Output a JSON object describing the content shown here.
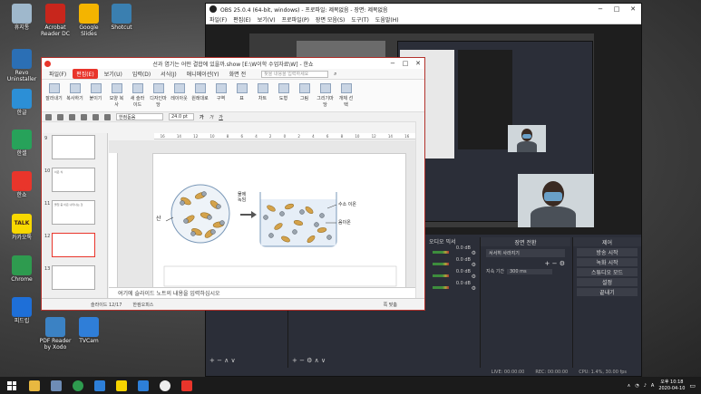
{
  "desktop": {
    "icons": [
      {
        "label": "휴지통",
        "color": "#9fb8cc"
      },
      {
        "label": "Acrobat Reader DC",
        "color": "#c8261c"
      },
      {
        "label": "Google Slides",
        "color": "#f4b400"
      },
      {
        "label": "Shotcut",
        "color": "#3a7fb0"
      },
      {
        "label": "Revo Uninstaller",
        "color": "#2b6fb5"
      },
      {
        "label": "한글",
        "color": "#2c8fd6"
      },
      {
        "label": "한셀",
        "color": "#27a25a"
      },
      {
        "label": "한쇼",
        "color": "#e9352b"
      },
      {
        "label": "카카오톡",
        "color": "#f8d800",
        "badge": "TALK"
      },
      {
        "label": "Chrome",
        "color": "#2e9b4f"
      },
      {
        "label": "피드립",
        "color": "#1e6fd8"
      },
      {
        "label": "PDF Reader by Xodo",
        "color": "#3b82c4"
      },
      {
        "label": "TVCam",
        "color": "#2f7ed8"
      }
    ]
  },
  "obs": {
    "title": "OBS 25.0.4 (64-bit, windows) - 프로파일: 제목없음 - 장면: 제목없음",
    "menu": [
      "파일(F)",
      "편집(E)",
      "보기(V)",
      "프로파일(P)",
      "장면 모음(S)",
      "도구(T)",
      "도움말(H)"
    ],
    "mixer": {
      "header": "오디오 믹서",
      "levels": [
        "0.0 dB",
        "0.0 dB",
        "0.0 dB",
        "0.0 dB"
      ]
    },
    "transitions": {
      "header": "장면 전환",
      "type": "서서히 사라지기",
      "duration_label": "지속 기간",
      "duration_value": "300 ms"
    },
    "controls": {
      "header": "제어",
      "buttons": [
        "방송 시작",
        "녹화 시작",
        "스튜디오 모드",
        "설정",
        "끝내기"
      ]
    },
    "status": {
      "live": "LIVE: 00:00:00",
      "rec": "REC: 00:00:00",
      "cpu": "CPU: 1.4%, 30.00 fps"
    }
  },
  "show": {
    "title": "선과 염기는 어떤 결합에 있을까.show [E:\\W이학 수업자료\\W] - 한쇼",
    "tabs": [
      "파일(F)",
      "편집(E)",
      "보기(U)",
      "입력(D)",
      "서식(J)",
      "애니메이션(Y)",
      "화면 전"
    ],
    "active_tab": "편집(E)",
    "search_placeholder": "찾을 내용을 입력하세요",
    "ribbon": [
      "잘라내기",
      "복사하기",
      "붙이기",
      "모양 복사",
      "새 슬라이드",
      "디자인마당",
      "레이아웃",
      "원래대로",
      "구역",
      "표",
      "차트",
      "도형",
      "그림",
      "그리기마당",
      "개체 선택"
    ],
    "toolbar_font": "한컴돋움",
    "toolbar_size": "24.0 pt",
    "ruler": [
      "16",
      "14",
      "12",
      "10",
      "8",
      "6",
      "4",
      "2",
      "0",
      "2",
      "4",
      "6",
      "8",
      "10",
      "12",
      "14",
      "16"
    ],
    "thumbnails": [
      {
        "num": "9",
        "text": ""
      },
      {
        "num": "10",
        "text": "이온 식"
      },
      {
        "num": "11",
        "text": "물질 중 이온 나타나는 것"
      },
      {
        "num": "12",
        "text": ""
      },
      {
        "num": "13",
        "text": ""
      }
    ],
    "slide": {
      "left_label": "산",
      "arrow_label": "물에 녹임",
      "right_labels": [
        "수소 이온",
        "음이온"
      ]
    },
    "notes_placeholder": "여기에 슬라이드 노트의 내용을 입력하십시오",
    "status": {
      "slide": "슬라이드 12/17",
      "theme": "한컴오피스",
      "zoom": "쪽 맞춤"
    }
  },
  "taskbar": {
    "time": "오후 10:18",
    "date": "2020-04-10",
    "lang": "A"
  }
}
